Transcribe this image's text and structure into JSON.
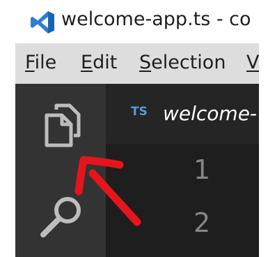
{
  "window": {
    "title": "welcome-app.ts - co",
    "app_icon": "vscode-icon"
  },
  "menubar": {
    "items": [
      {
        "mnemonic": "F",
        "rest": "ile"
      },
      {
        "mnemonic": "E",
        "rest": "dit"
      },
      {
        "mnemonic": "S",
        "rest": "election"
      },
      {
        "mnemonic": "V",
        "rest": ""
      }
    ]
  },
  "activitybar": {
    "items": [
      {
        "icon": "explorer-files-icon"
      },
      {
        "icon": "search-icon"
      }
    ]
  },
  "editor": {
    "tab": {
      "badge": "TS",
      "filename": "welcome-"
    },
    "line_numbers": [
      "1",
      "2"
    ]
  },
  "annotation": {
    "icon": "red-arrow-icon",
    "color": "#e8141c"
  },
  "colors": {
    "activitybar": "#333333",
    "editor_bg": "#1e1e1e",
    "tabstrip_bg": "#252526",
    "menubar_bg": "#dddddd",
    "icon_gray": "#bdbdbd",
    "ts_blue": "#569cd6"
  }
}
